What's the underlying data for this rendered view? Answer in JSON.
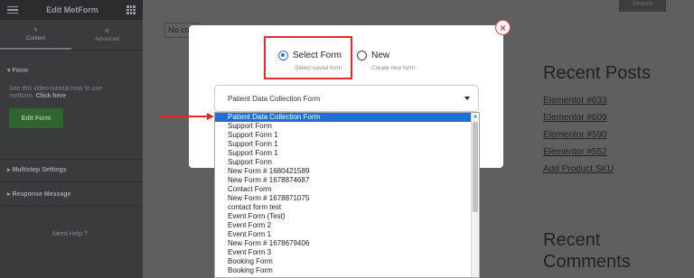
{
  "panel": {
    "title": "Edit MetForm",
    "tabs": [
      {
        "label": "Content"
      },
      {
        "label": "Advanced"
      }
    ],
    "form_section": "Form",
    "tutorial_text": "See this video tutorial how to use metform.",
    "tutorial_link": "Click here",
    "edit_form_button": "Edit Form",
    "multistep_section": "Multistep Settings",
    "response_section": "Response Message",
    "need_help": "Need Help"
  },
  "page": {
    "search_button": "Search",
    "no_content": "No co",
    "recent_posts_title": "Recent Posts",
    "recent_posts": [
      "Elementor #633",
      "Elementor #609",
      "Elementor #590",
      "Elementor #552",
      "Add Product SKU"
    ],
    "recent_comments_title": "Recent Comments"
  },
  "modal": {
    "option_select": {
      "label": "Select Form",
      "sub": "Select saved form"
    },
    "option_new": {
      "label": "New",
      "sub": "Create new form"
    },
    "selected_form": "Patient Data Collection Form",
    "dropdown_items": [
      "Patient Data Collection Form",
      "Support Form",
      "Support Form 1",
      "Support Form 1",
      "Support Form 1",
      "Support Form",
      "New Form # 1680421589",
      "New Form # 1678874687",
      "Contact Form",
      "New Form # 1678871075",
      "contact form test",
      "Event Form (Test)",
      "Event Form 2",
      "Event Form 1",
      "New Form # 1678679406",
      "Event Form 3",
      "Booking Form",
      "Booking Form"
    ]
  },
  "colors": {
    "accent": "#2f75d6",
    "annotation": "#e2282e",
    "edit_button": "#30652d"
  }
}
